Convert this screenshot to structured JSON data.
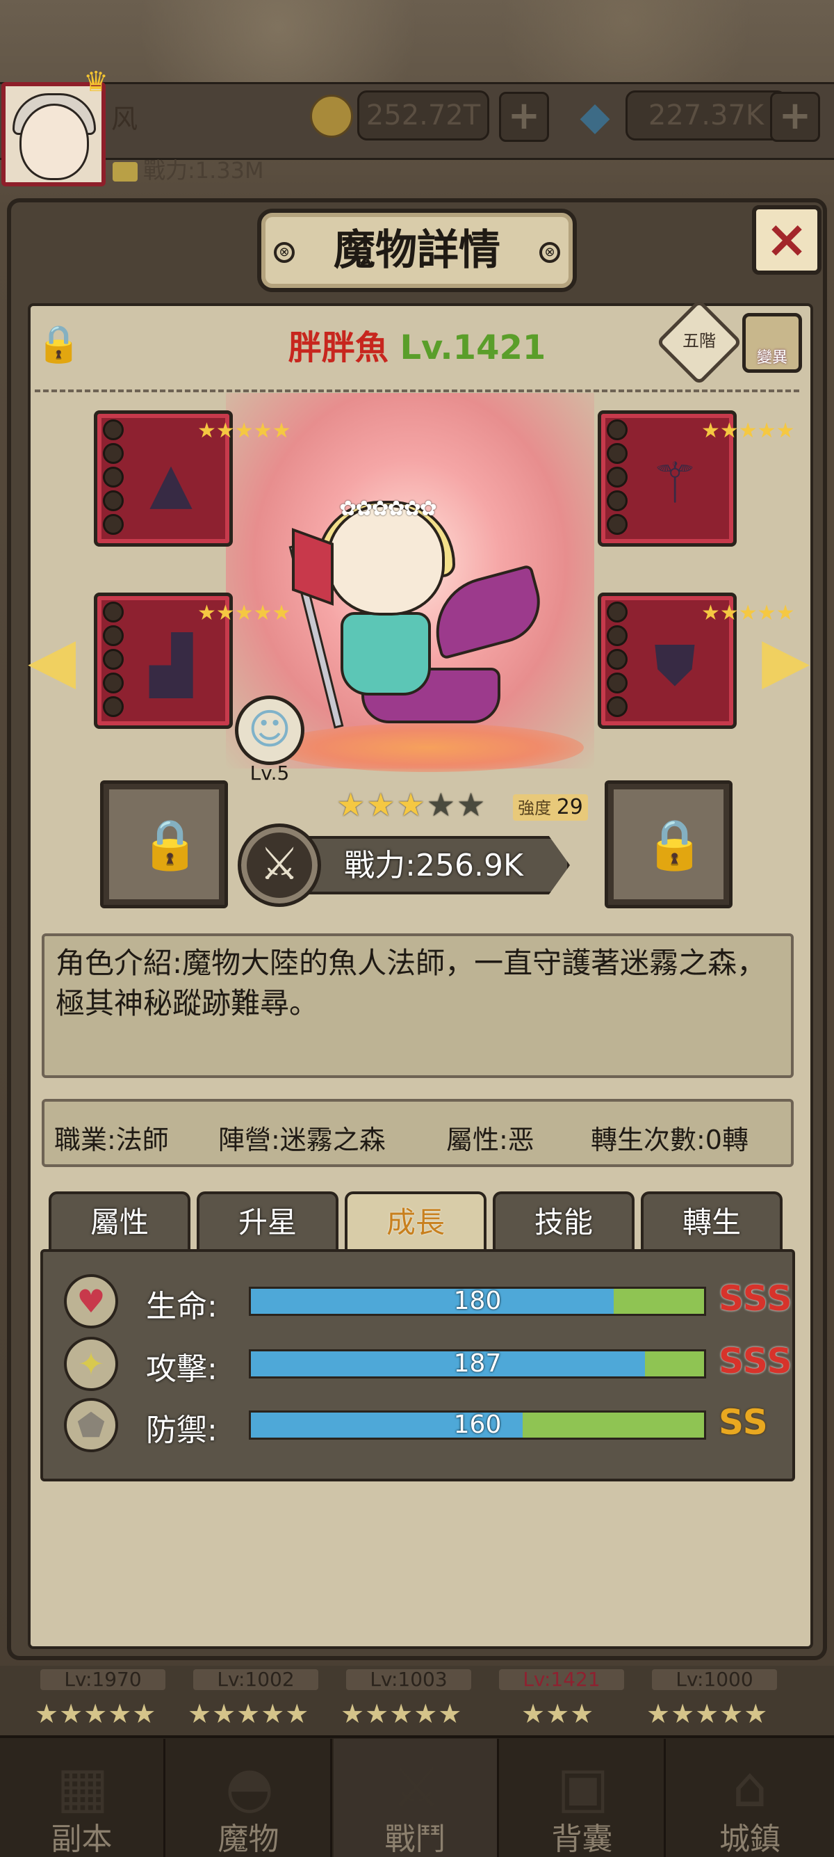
{
  "player": {
    "name": "风",
    "power": "戰力:1.33M",
    "coins": "252.72T",
    "gems": "227.37K",
    "plus": "+",
    "crown": "♛"
  },
  "dialog": {
    "title": "魔物詳情",
    "close": "×",
    "bolt": "⊗"
  },
  "monster": {
    "name": "胖胖魚",
    "level": "Lv.1421",
    "rank": "五階",
    "mutation": "變異",
    "stars_on": "★★★",
    "stars_off": "★★",
    "strength_label": "強度",
    "strength_value": "29",
    "power": "戰力:256.9K",
    "pet_level": "Lv.5",
    "crown_flowers": "✿✿✿✿✿✿"
  },
  "description": "角色介紹:魔物大陸的魚人法師，一直守護著迷霧之森，極其神秘蹤跡難尋。",
  "info": {
    "job": "職業:法師",
    "camp": "陣營:迷霧之森",
    "attribute": "屬性:恶",
    "rebirth": "轉生次數:0轉"
  },
  "tabs": [
    "屬性",
    "升星",
    "成長",
    "技能",
    "轉生"
  ],
  "active_tab": "成長",
  "stats": [
    {
      "label": "生命:",
      "value": "180",
      "fill": 0.8,
      "grade": "SSS",
      "icon": "heart-icon"
    },
    {
      "label": "攻擊:",
      "value": "187",
      "fill": 0.87,
      "grade": "SSS",
      "icon": "sword-icon"
    },
    {
      "label": "防禦:",
      "value": "160",
      "fill": 0.6,
      "grade": "SS",
      "icon": "shield-icon"
    }
  ],
  "equipment": {
    "stars": "★★★★★"
  },
  "background": {
    "levels": [
      "Lv:1970",
      "Lv:1002",
      "Lv:1003",
      "Lv:1421",
      "Lv:1000"
    ]
  },
  "nav": [
    "副本",
    "魔物",
    "戰鬥",
    "背囊",
    "城鎮"
  ],
  "nav_active": "戰鬥",
  "icons": {
    "lock": "🔒",
    "arrow_left": "◀",
    "arrow_right": "▶",
    "swords": "⚔",
    "gem": "◆",
    "heart": "♥",
    "sword": "✦",
    "shield": "⬟",
    "pet": "☺"
  },
  "colors": {
    "name_red": "#c7261e",
    "level_green": "#5a9e2a",
    "grade_sss": "#d7332b",
    "grade_ss": "#e9a820",
    "bar_blue": "#4ea8d8",
    "bar_green": "#8fc453"
  }
}
